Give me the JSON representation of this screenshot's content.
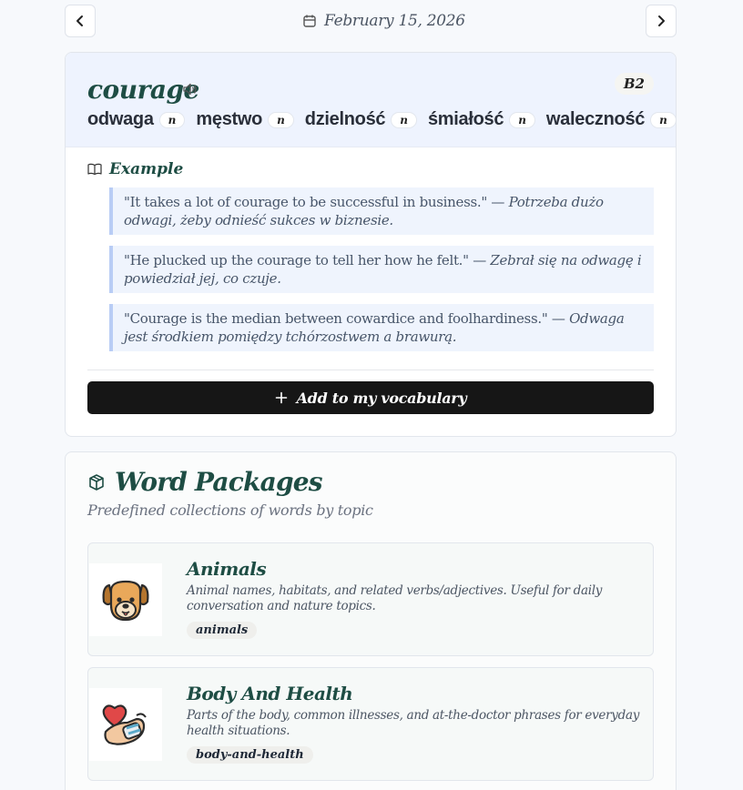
{
  "date_nav": {
    "date": "February 15, 2026",
    "prev_icon": "chevron-left-icon",
    "next_icon": "chevron-right-icon",
    "calendar_icon": "calendar-icon"
  },
  "word_card": {
    "word": "courage",
    "level": "B2",
    "translations": [
      {
        "word": "odwaga",
        "pos": "n"
      },
      {
        "word": "męstwo",
        "pos": "n"
      },
      {
        "word": "dzielność",
        "pos": "n"
      },
      {
        "word": "śmiałość",
        "pos": "n"
      },
      {
        "word": "waleczność",
        "pos": "n"
      }
    ],
    "example_heading": "Example",
    "examples": [
      {
        "en": "\"It takes a lot of courage to be successful in business.\" —",
        "pl": "Potrzeba dużo odwagi, żeby odnieść sukces w biznesie."
      },
      {
        "en": "\"He plucked up the courage to tell her how he felt.\" —",
        "pl": "Zebrał się na odwagę i powiedział jej, co czuje."
      },
      {
        "en": "\"Courage is the median between cowardice and foolhardiness.\" —",
        "pl": "Odwaga jest środkiem pomiędzy tchórzostwem a brawurą."
      }
    ],
    "add_button": "Add to my vocabulary"
  },
  "packages": {
    "title": "Word Packages",
    "subtitle": "Predefined collections of words by topic",
    "items": [
      {
        "name": "Animals",
        "description": "Animal names, habitats, and related verbs/adjectives. Useful for daily conversation and nature topics.",
        "tag": "animals",
        "icon": "dog-icon"
      },
      {
        "name": "Body And Health",
        "description": "Parts of the body, common illnesses, and at-the-doctor phrases for everyday health situations.",
        "tag": "body-and-health",
        "icon": "heart-hand-icon"
      }
    ]
  },
  "colors": {
    "accent_green": "#1e4d44",
    "header_bg": "#eef3fe",
    "button_bg": "#161616",
    "quote_border": "#b9cdf5"
  }
}
